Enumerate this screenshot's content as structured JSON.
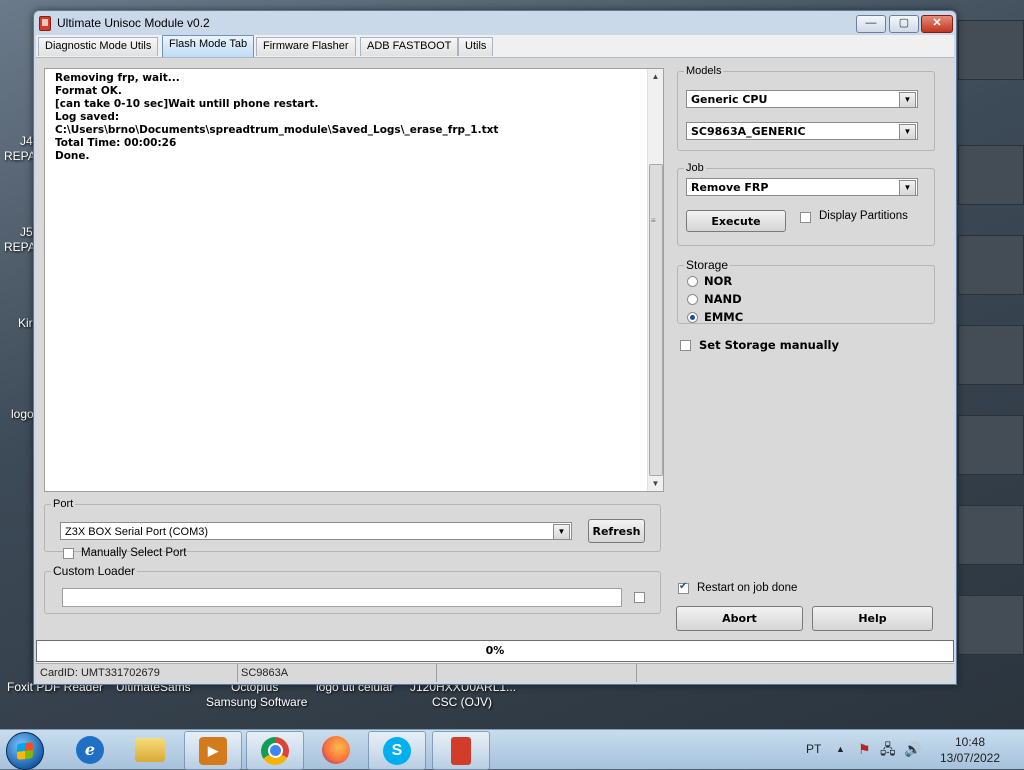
{
  "window": {
    "title": "Ultimate Unisoc Module v0.2",
    "minimize": "—",
    "maximize": "▢",
    "close": "✕"
  },
  "tabs": [
    {
      "label": "Diagnostic  Mode Utils"
    },
    {
      "label": "Flash Mode Tab",
      "active": true
    },
    {
      "label": "Firmware Flasher"
    },
    {
      "label": "ADB FASTBOOT"
    },
    {
      "label": "Utils"
    }
  ],
  "log": {
    "text": "Removing frp, wait...\nFormat OK.\n[can take 0-10 sec]Wait untill phone restart.\nLog saved:\nC:\\Users\\brno\\Documents\\spreadtrum_module\\Saved_Logs\\_erase_frp_1.txt\nTotal Time: 00:00:26\nDone."
  },
  "models": {
    "legend": "Models",
    "cpu_value": "Generic CPU",
    "model_value": "SC9863A_GENERIC"
  },
  "job": {
    "legend": "Job",
    "value": "Remove FRP",
    "execute_label": "Execute",
    "display_partitions_label": "Display Partitions"
  },
  "storage": {
    "legend": "Storage",
    "options": [
      "NOR",
      "NAND",
      "EMMC"
    ],
    "selected": "EMMC",
    "manual_label": "Set Storage manually"
  },
  "port": {
    "legend": "Port",
    "value": "Z3X BOX Serial Port (COM3)",
    "refresh_label": "Refresh",
    "manual_label": "Manually Select Port"
  },
  "loader": {
    "legend": "Custom Loader",
    "value": ""
  },
  "options": {
    "restart_label": "Restart on job done",
    "abort_label": "Abort",
    "help_label": "Help"
  },
  "progress": {
    "label": "0%",
    "value": 0
  },
  "status": {
    "card_id": "CardID: UMT331702679",
    "chip": "SC9863A"
  },
  "desktop": {
    "left_icons": [
      "J4:",
      "REPA",
      "J5:",
      "REPA",
      "Kir",
      "logo"
    ],
    "bottom_icons": [
      "Foxit PDF Reader",
      "UltimateSams",
      "Octoplus",
      "Samsung Software",
      "logo uti celular",
      "J120HXXU0ARL1...",
      "CSC (OJV)"
    ]
  },
  "taskbar": {
    "language": "PT",
    "time": "10:48",
    "date": "13/07/2022"
  }
}
